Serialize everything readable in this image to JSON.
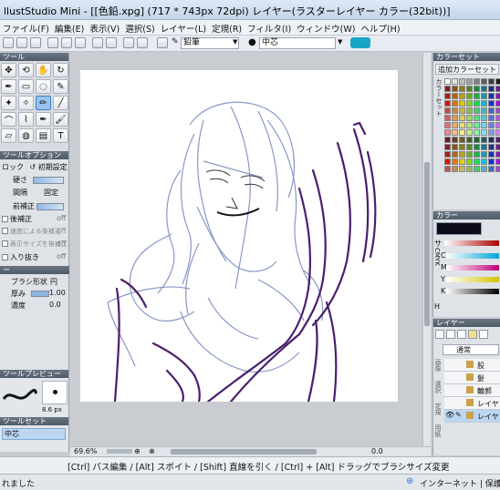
{
  "window": {
    "title": "llustStudio Mini - [[色鉛.xpg] (717 * 743px 72dpi)  レイヤー(ラスターレイヤー カラー(32bit))]"
  },
  "menu": [
    "ファイル(F)",
    "編集(E)",
    "表示(V)",
    "選択(S)",
    "レイヤー(L)",
    "定規(R)",
    "フィルタ(I)",
    "ウィンドウ(W)",
    "ヘルプ(H)"
  ],
  "toolbar": {
    "brush_select": "鉛筆",
    "position_select": "中芯"
  },
  "tool_panel": {
    "header": "ツール",
    "icons": [
      "move-icon",
      "lasso-icon",
      "hand-icon",
      "rotate-icon",
      "eyedropper-icon",
      "select-rect-icon",
      "select-lasso-icon",
      "select-pen-icon",
      "select-wand-icon",
      "magic-wand-icon",
      "pencil-icon",
      "line-icon",
      "curve-icon",
      "polyline-icon",
      "pen-icon",
      "brush-icon",
      "eraser-icon",
      "bucket-icon",
      "gradient-icon",
      "text-icon",
      "dot-icon",
      "stamp-icon",
      "smudge-icon",
      "blur-icon",
      "airbrush-icon"
    ]
  },
  "tool_options": {
    "header": "ツールオプション",
    "lock_label": "ロック",
    "reset_label": "初期設定",
    "hardness_label": "硬さ",
    "interval_label": "間隔",
    "fixed_label": "固定",
    "pre_correction_label": "前補正",
    "post_correction_label": "後補正",
    "post_correction_value": "off",
    "speed_correction_label": "速度による後補正",
    "speed_correction_value": "off",
    "size_correction_label": "表示サイズを後補正...",
    "size_correction_value": "off",
    "entry_exit_label": "入り抜き",
    "entry_exit_value": "off",
    "brush_header": "ー",
    "brush_shape_label": "ブラシ形状",
    "brush_shape_value": "円",
    "thickness_label": "厚み",
    "thickness_value": "1.00",
    "density_label": "濃度",
    "density_value": "0.0"
  },
  "brush_preview": {
    "header": "ツールプレビュー",
    "size_text": "8.6 px"
  },
  "tool_set": {
    "header": "ツールセット",
    "selected": "中芯"
  },
  "color_set": {
    "header": "カラーセット",
    "add_button": "追加カラーセット",
    "side_label": "カラーセット"
  },
  "color_panel": {
    "header": "カラー",
    "labels": [
      "サ",
      "C",
      "M",
      "Y",
      "K",
      "CMYK",
      "H"
    ]
  },
  "layer_panel": {
    "header": "レイヤー",
    "blend_mode": "通常",
    "side_labels": [
      "画像",
      "選択",
      "定規",
      "用紙"
    ],
    "layers": [
      "股",
      "髪",
      "輪郭",
      "レイヤ",
      "レイヤ"
    ]
  },
  "canvas_footer": {
    "zoom": "69.6%",
    "angle": "0.0"
  },
  "hint": "[Ctrl] パス編集 / [Alt] スポイト / [Shift] 直線を引く / [Ctrl] + [Alt] ドラッグでブラシサイズ変更",
  "status": {
    "left": "れました",
    "zone": "インターネット | 保護モ"
  },
  "colors": {
    "accent": "#4f5a68",
    "drawing_purple": "#4a1f6e",
    "sketch_blue": "#7c8cc0"
  }
}
